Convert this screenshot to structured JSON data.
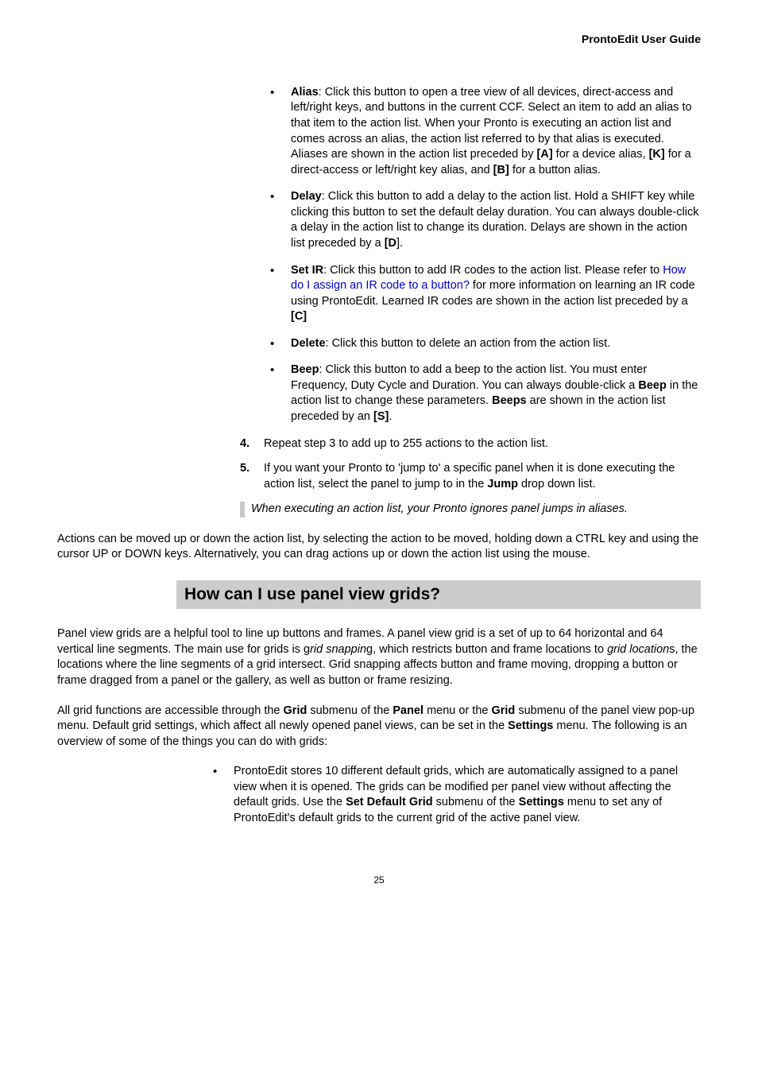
{
  "header": {
    "title": "ProntoEdit User Guide"
  },
  "actions": {
    "alias": "<b>Alias</b>: Click this button to open a tree view of all devices, direct-access and left/right keys, and buttons in the current CCF. Select an item to add an alias to that item to the action list. When your Pronto is executing an action list and comes across an alias, the action list referred to by that alias is executed. Aliases are shown in the action list preceded by <b>[A]</b> for a device alias, <b>[K]</b> for a direct-access or left/right key alias, and <b>[B]</b> for a button alias.",
    "delay": "<b>Delay</b>: Click this button to add a delay to the action list. Hold a SHIFT key while clicking this button to set the default delay duration. You can always double-click a delay in the action list to change its duration. Delays are shown in the action list preceded by a <b>[D</b>].",
    "setir": "<b>Set IR</b>: Click this button to add IR codes to the action list. Please refer to <span class=\"link\">How do I assign an IR code to a button?</span> for more information on learning an IR code using ProntoEdit. Learned IR codes are shown in the action list preceded by a <b>[C]</b>",
    "delete": "<b>Delete</b>: Click this button to delete an action from the action list.",
    "beep": "<b>Beep</b>: Click this button to add a beep to the action list. You must enter Frequency, Duty Cycle and Duration. You can always double-click a <b>Beep</b> in the action list to change these parameters. <b>Beeps</b> are shown in the action list preceded by an <b>[S]</b>."
  },
  "steps": {
    "s4": "Repeat step 3 to add up to 255 actions to the action list.",
    "s5": "If you want your Pronto to 'jump to' a specific panel when it is done executing the action list, select the panel to jump to in the <b>Jump</b> drop down list."
  },
  "note": "When executing an action list, your Pronto ignores panel jumps in aliases.",
  "para_after_note": "Actions can be moved up or down the action list, by selecting the action to be moved, holding down a CTRL key and using the cursor UP or DOWN keys. Alternatively, you can drag actions up or down the action list using the mouse.",
  "section_title": "How can I use panel view grids?",
  "grid_para1": "Panel view grids are a helpful tool to line up buttons and frames. A panel view grid is a set of up to 64 horizontal and 64 vertical line segments. The main use for grids is g<i>rid snappin</i>g, which restricts button and frame locations to <i>grid location</i>s, the locations where the line segments of a grid intersect. Grid snapping affects button and frame moving, dropping a button or frame dragged from a panel or the gallery, as well as button or frame resizing.",
  "grid_para2": "All grid functions are accessible through the <b>Grid</b> submenu of the <b>Panel</b> menu or the <b>Grid</b> submenu of the panel view pop-up menu. Default grid settings, which affect all newly opened panel views, can be set in the <b>Settings</b> menu. The following is an overview of some of the things you can do with grids:",
  "grid_bullet1": "ProntoEdit stores 10 different default grids, which are automatically assigned to a panel view when it is opened. The grids can be modified per panel view without affecting the default grids. Use the <b>Set Default Grid</b> submenu of the <b>Settings</b> menu to set any of ProntoEdit's default grids to the current grid of the active panel view.",
  "page_number": "25"
}
